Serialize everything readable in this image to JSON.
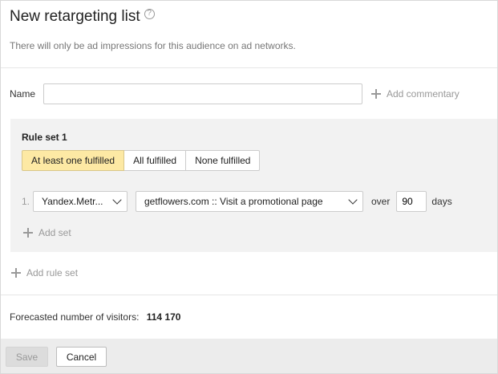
{
  "header": {
    "title": "New retargeting list",
    "help_glyph": "?",
    "subtitle": "There will only be ad impressions for this audience on ad networks."
  },
  "name_field": {
    "label": "Name",
    "value": "",
    "placeholder": ""
  },
  "commentary": {
    "label": "Add commentary"
  },
  "rule_set": {
    "title": "Rule set 1",
    "modes": [
      {
        "label": "At least one fulfilled",
        "active": true
      },
      {
        "label": "All fulfilled",
        "active": false
      },
      {
        "label": "None fulfilled",
        "active": false
      }
    ],
    "rules": [
      {
        "index": "1.",
        "source": "Yandex.Metr...",
        "goal": "getflowers.com :: Visit a promotional page",
        "over_label": "over",
        "days_value": "90",
        "days_label": "days"
      }
    ],
    "add_set_label": "Add set"
  },
  "add_rule_set_label": "Add rule set",
  "forecast": {
    "label": "Forecasted number of visitors:",
    "value": "114 170"
  },
  "footer": {
    "save_label": "Save",
    "cancel_label": "Cancel"
  },
  "colors": {
    "active_mode_bg": "#fde9a4",
    "ruleset_bg": "#f2f2f2",
    "footer_bg": "#ececec",
    "muted_text": "#999999"
  }
}
